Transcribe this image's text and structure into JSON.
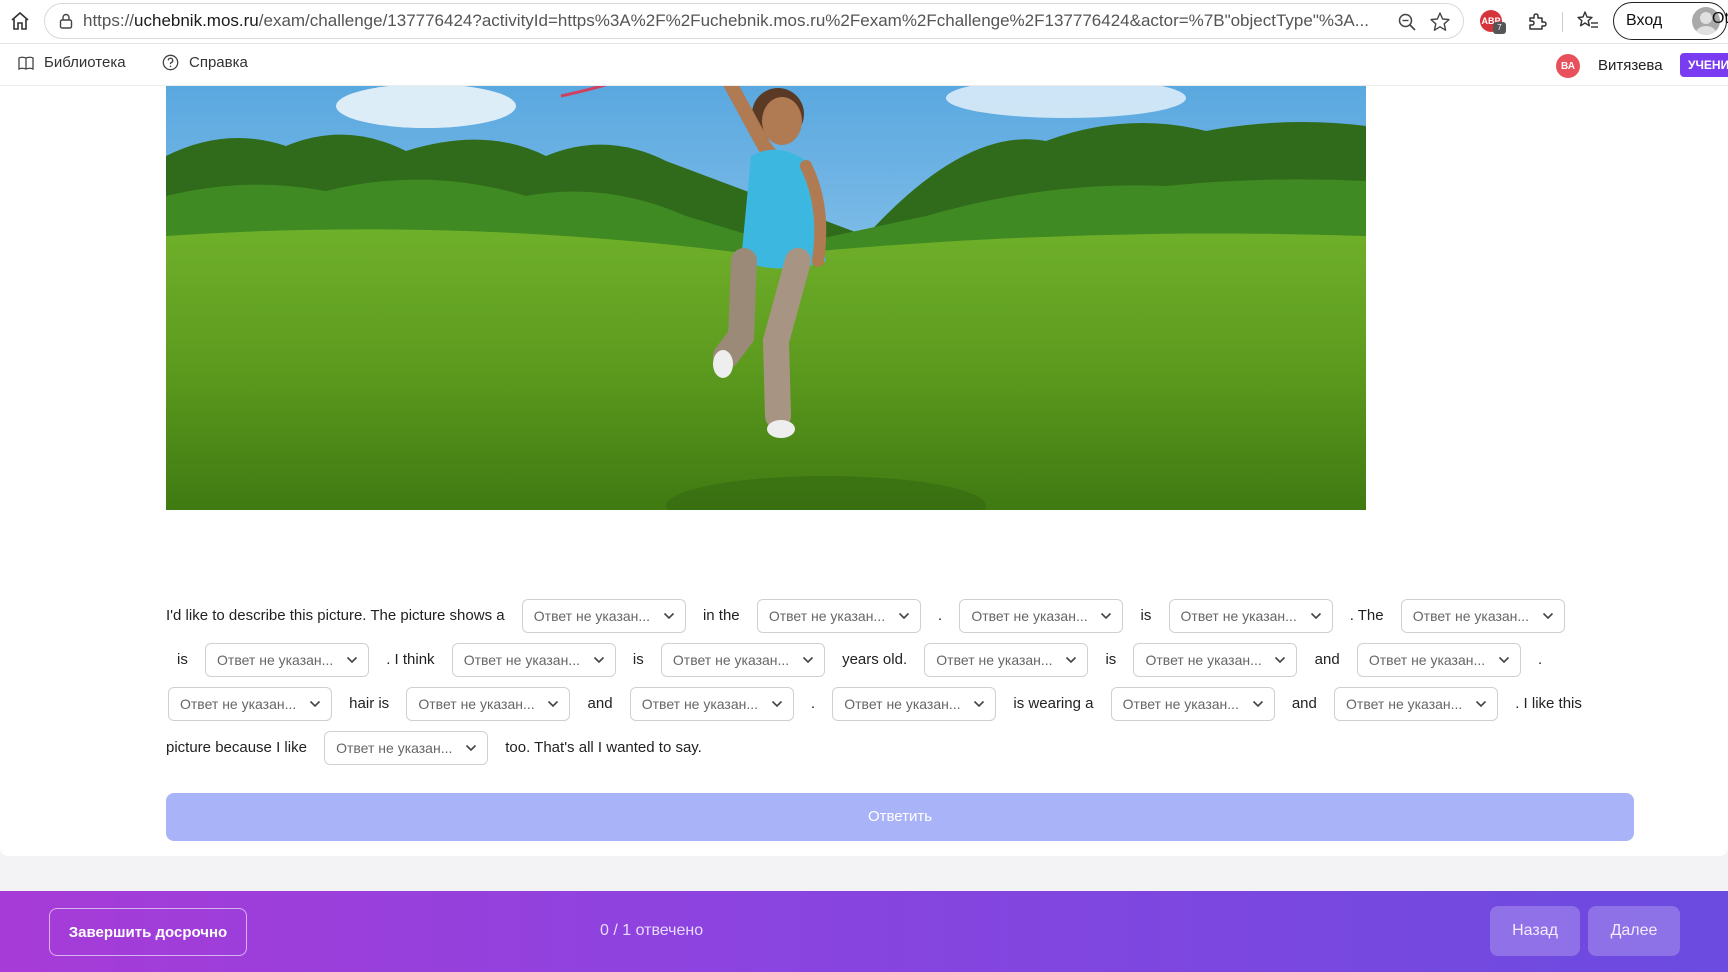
{
  "browser": {
    "url_prefix": "https://",
    "url_host": "uchebnik.mos.ru",
    "url_rest": "/exam/challenge/137776424?activityId=https%3A%2F%2Fuchebnik.mos.ru%2Fexam%2Fchallenge%2F137776424&actor=%7B\"objectType\"%3A...",
    "login_label": "Вход",
    "cutoff_label": "Ot",
    "ext_abp_label": "ABP",
    "ext_abp_count": "7"
  },
  "nav": {
    "library_label": "Библиотека",
    "help_label": "Справка",
    "user_initials": "ВА",
    "user_name": "Витязева",
    "role_label": "УЧЕНИ"
  },
  "task": {
    "picture_icon": "boy-running-on-grass-photo",
    "placeholder": "Ответ не указан...",
    "text": {
      "t1": "I'd like to describe this picture. The picture shows a",
      "t2": "in the",
      "t3": ".",
      "t4": "is",
      "t5": ". The",
      "t6": "is",
      "t7": ". I think",
      "t8": "is",
      "t9": "years old.",
      "t10": "is",
      "t11": "and",
      "t12": ".",
      "t13": "hair is",
      "t14": "and",
      "t15": ".",
      "t16": "is wearing a",
      "t17": "and",
      "t18": ". I like this picture because I like",
      "t19": "too. That's all I wanted to say."
    },
    "answer_label": "Ответить"
  },
  "footer": {
    "finish_label": "Завершить досрочно",
    "progress": "0 / 1 отвечено",
    "back_label": "Назад",
    "next_label": "Далее"
  },
  "colors": {
    "accent": "#7a3cf0",
    "answer_button": "#a9b3f8",
    "footer_gradient_start": "#a73bd7",
    "footer_gradient_end": "#6b4be0"
  }
}
